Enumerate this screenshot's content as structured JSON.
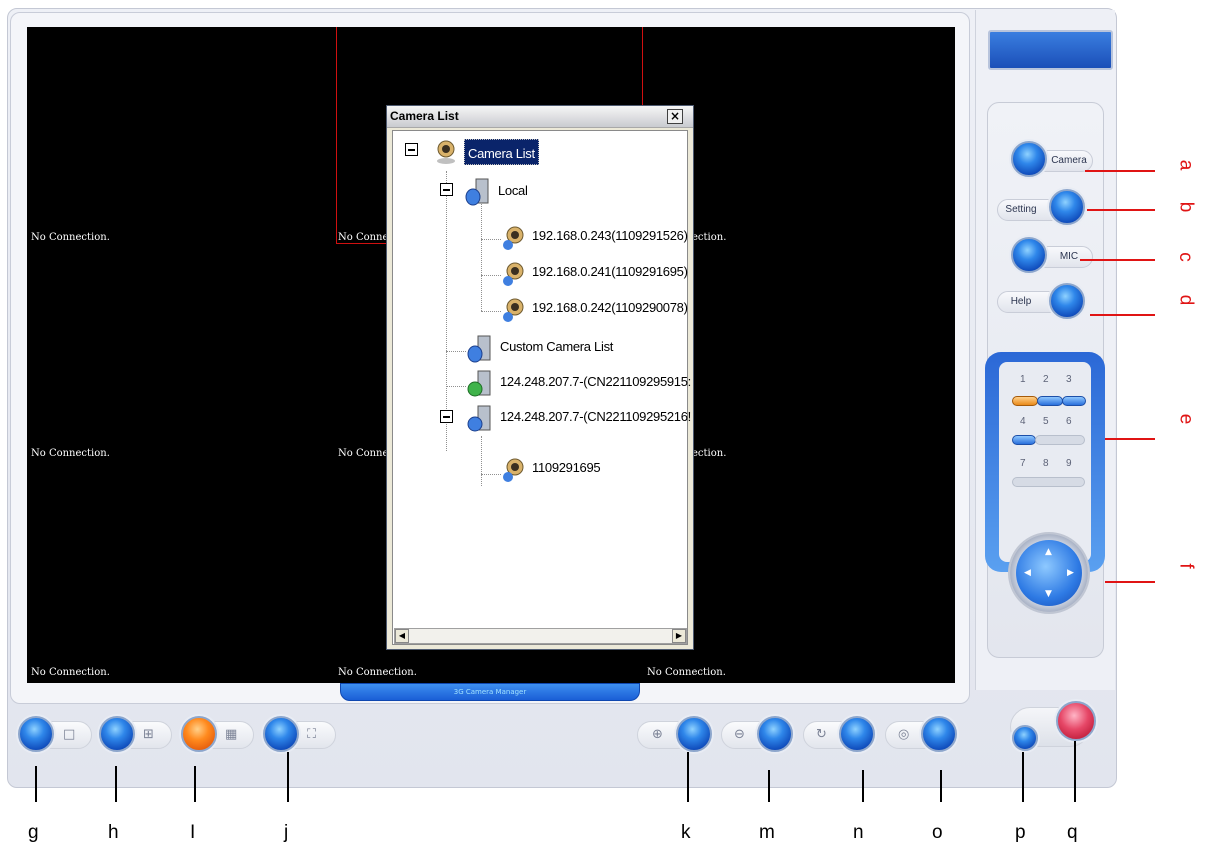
{
  "video": {
    "cells": [
      {
        "label": "No Connection."
      },
      {
        "label": "No Conne"
      },
      {
        "label": "ection."
      },
      {
        "label": "No Connection."
      },
      {
        "label": "No Conne"
      },
      {
        "label": "ection."
      },
      {
        "label": "No Connection."
      },
      {
        "label": "No Connection."
      },
      {
        "label": "No Connection."
      }
    ],
    "title_tab": "3G Camera Manager"
  },
  "dialog": {
    "title": "Camera List",
    "close_glyph": "×",
    "tree": [
      {
        "label": "Camera List",
        "icon": "webcam-icon"
      },
      {
        "label": "Local",
        "icon": "server-icon"
      },
      {
        "label": "192.168.0.243(1109291526)",
        "icon": "webcam-icon"
      },
      {
        "label": "192.168.0.241(1109291695)",
        "icon": "webcam-icon"
      },
      {
        "label": "192.168.0.242(1109290078)",
        "icon": "webcam-icon"
      },
      {
        "label": "Custom Camera List",
        "icon": "server-icon"
      },
      {
        "label": "124.248.207.7-(CN221109295915:",
        "icon": "server-green-icon"
      },
      {
        "label": "124.248.207.7-(CN221109295216!",
        "icon": "server-blue-icon"
      },
      {
        "label": "1109291695",
        "icon": "webcam-icon"
      }
    ]
  },
  "right_panel": {
    "camera_label": "Camera",
    "setting_label": "Setting",
    "mic_label": "MIC",
    "help_label": "Help",
    "presets": [
      "1",
      "2",
      "3",
      "4",
      "5",
      "6",
      "7",
      "8",
      "9"
    ]
  },
  "annotations": {
    "right": [
      "a",
      "b",
      "c",
      "d",
      "e",
      "f"
    ],
    "bottom": [
      "g",
      "h",
      "I",
      "j",
      "k",
      "m",
      "n",
      "o",
      "p",
      "q"
    ]
  },
  "colors": {
    "accent_blue": "#2f87ea",
    "annotation_red": "#e01414",
    "selected_border": "#d01010"
  }
}
